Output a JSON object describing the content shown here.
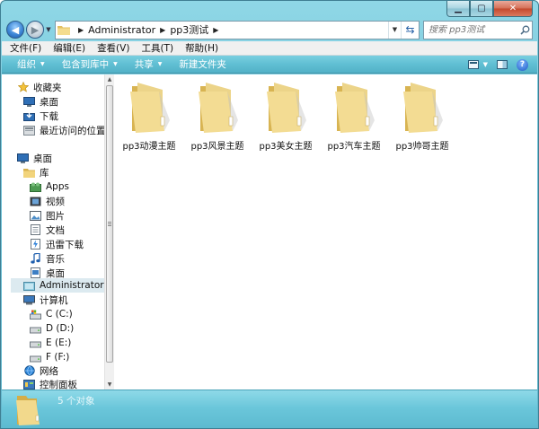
{
  "window": {
    "minimize_symbol": "▁",
    "maximize_symbol": "▢",
    "close_symbol": "✕"
  },
  "address": {
    "crumbs": [
      "Administrator",
      "pp3测试"
    ],
    "search_placeholder": "搜索 pp3测试"
  },
  "menu": [
    "文件(F)",
    "编辑(E)",
    "查看(V)",
    "工具(T)",
    "帮助(H)"
  ],
  "commands": [
    {
      "label": "组织",
      "has_dropdown": true
    },
    {
      "label": "包含到库中",
      "has_dropdown": true
    },
    {
      "label": "共享",
      "has_dropdown": true
    },
    {
      "label": "新建文件夹",
      "has_dropdown": false
    }
  ],
  "nav": [
    {
      "label": "收藏夹",
      "icon": "star-icon"
    },
    {
      "label": "桌面",
      "icon": "desktop-icon"
    },
    {
      "label": "下载",
      "icon": "download-icon"
    },
    {
      "label": "最近访问的位置",
      "icon": "recent-places-icon"
    },
    {
      "label": "桌面",
      "icon": "desktop-icon"
    },
    {
      "label": "库",
      "icon": "library-icon"
    },
    {
      "label": "Apps",
      "icon": "apps-icon"
    },
    {
      "label": "视频",
      "icon": "video-icon"
    },
    {
      "label": "图片",
      "icon": "picture-icon"
    },
    {
      "label": "文档",
      "icon": "document-icon"
    },
    {
      "label": "迅雷下载",
      "icon": "thunder-download-icon"
    },
    {
      "label": "音乐",
      "icon": "music-icon"
    },
    {
      "label": "桌面",
      "icon": "desktop-icon"
    },
    {
      "label": "Administrator",
      "icon": "user-folder-icon",
      "selected": true
    },
    {
      "label": "计算机",
      "icon": "computer-icon"
    },
    {
      "label": "C (C:)",
      "icon": "system-drive-icon"
    },
    {
      "label": "D (D:)",
      "icon": "drive-icon"
    },
    {
      "label": "E (E:)",
      "icon": "drive-icon"
    },
    {
      "label": "F (F:)",
      "icon": "drive-icon"
    },
    {
      "label": "网络",
      "icon": "network-icon"
    },
    {
      "label": "控制面板",
      "icon": "control-panel-icon"
    }
  ],
  "folders": [
    "pp3动漫主题",
    "pp3风景主题",
    "pp3美女主题",
    "pp3汽车主题",
    "pp3帅哥主题"
  ],
  "details": {
    "item_count": "5 个对象"
  },
  "colors": {
    "folder_body": "#f1d47f",
    "folder_back": "#dcb85a",
    "command_bar": "#5fbfd3",
    "details_pane": "#6ac6da"
  }
}
